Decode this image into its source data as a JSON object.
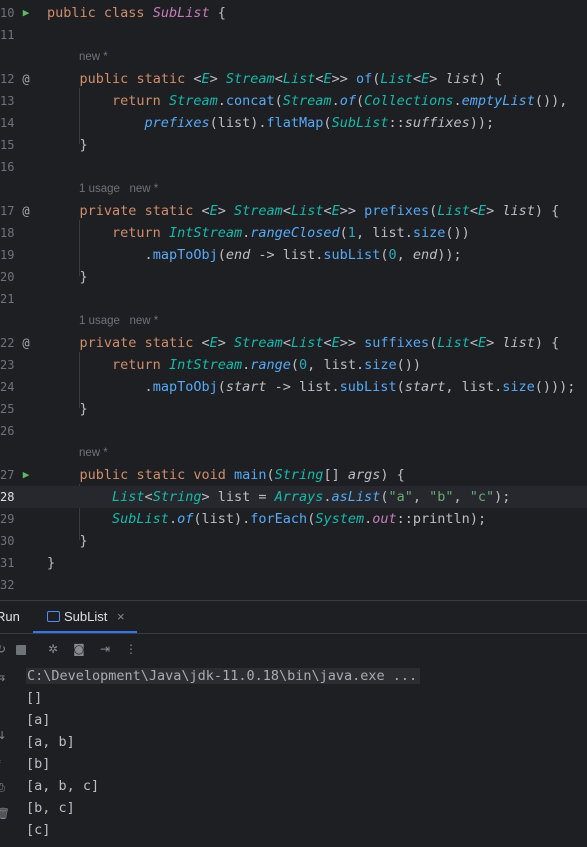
{
  "colors": {
    "background": "#1e1f22",
    "keyword": "#cf8e6d",
    "type": "#16baac",
    "string": "#6aab73",
    "number": "#2aacb8",
    "method": "#56a8f5",
    "run_icon": "#5fb865",
    "tab_accent": "#3574f0"
  },
  "editor": {
    "line_numbers": [
      "10",
      "11",
      "12",
      "13",
      "14",
      "15",
      "16",
      "17",
      "18",
      "19",
      "20",
      "21",
      "22",
      "23",
      "24",
      "25",
      "26",
      "27",
      "28",
      "29",
      "30",
      "31",
      "32"
    ],
    "current_line": "28",
    "hints": {
      "of": "new *",
      "prefixes": "1 usage   new *",
      "suffixes": "1 usage   new *",
      "main": "new *"
    },
    "gutter_icons": {
      "run": "run-arrow-icon",
      "override": "implements-at-icon"
    },
    "tokens": {
      "public": "public",
      "class": "class",
      "static": "static",
      "private": "private",
      "return": "return",
      "void": "void",
      "class_name": "SubList",
      "open_brace": " {",
      "close_brace": "}",
      "l12_a": "<",
      "l12_E": "E",
      "l12_b": "> ",
      "Stream": "Stream",
      "lt": "<",
      "List": "List",
      "gtgt": ">> ",
      "of": "of",
      "lparen": "(",
      "list_param": "list",
      "rparen_brace": ") {",
      "gt_sp": "> ",
      "concat": "concat",
      "dot": ".",
      "Collections": "Collections",
      "emptyList": "emptyList",
      "l13_end": "()),",
      "prefixes": "prefixes",
      "flatMap": "flatMap",
      "suffixes": "suffixes",
      "coloncolon": "::",
      "l14_end": "));",
      "IntStream": "IntStream",
      "rangeClosed": "rangeClosed",
      "one": "1",
      "comma_sp": ", ",
      "size": "size",
      "l18_end": "())",
      "mapToObj": "mapToObj",
      "end": "end",
      "arrow": " -> ",
      "subList": "subList",
      "zero": "0",
      "l19_end": "));",
      "range": "range",
      "start": "start",
      "l24_end": "()));",
      "main": "main",
      "String": "String",
      "arr_sp": "[] ",
      "args": "args",
      "gt_list": "> list = ",
      "Arrays": "Arrays",
      "asList": "asList",
      "a": "\"a\"",
      "b": "\"b\"",
      "c": "\"c\"",
      "l28_end": ");",
      "list_var": "list",
      "forEach": "forEach",
      "System": "System",
      "out": "out",
      "println": "println",
      "l29_end": ");",
      "rparen": ")",
      "rparen2": "))"
    }
  },
  "run_panel": {
    "run_tab_label": "Run",
    "config_tab_label": "SubList",
    "close_glyph": "×",
    "toolbar_icons": [
      "rerun-icon",
      "stop-icon",
      "debug-icon",
      "screenshot-icon",
      "exit-icon",
      "more-icon"
    ],
    "command_line": "C:\\Development\\Java\\jdk-11.0.18\\bin\\java.exe ...",
    "output": [
      "[]",
      "[a]",
      "[a, b]",
      "[b]",
      "[a, b, c]",
      "[b, c]",
      "[c]"
    ]
  }
}
